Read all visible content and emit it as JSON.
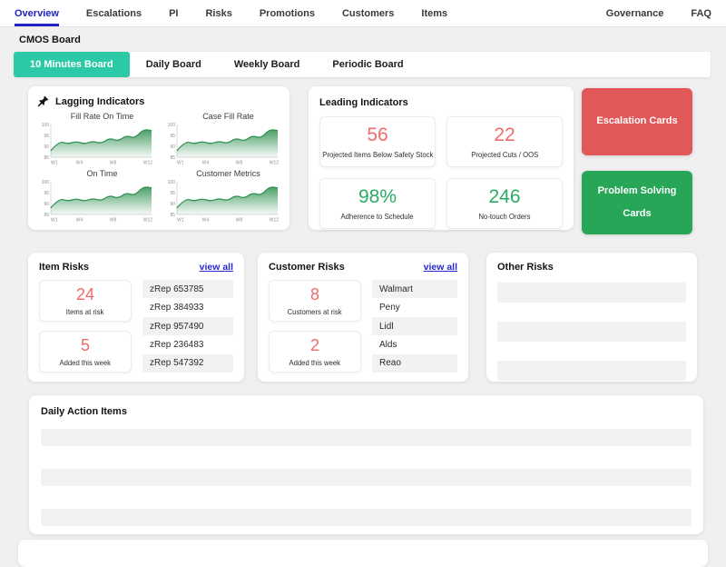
{
  "nav": {
    "items": [
      {
        "label": "Overview",
        "active": true
      },
      {
        "label": "Escalations"
      },
      {
        "label": "PI"
      },
      {
        "label": "Risks"
      },
      {
        "label": "Promotions"
      },
      {
        "label": "Customers"
      },
      {
        "label": "Items"
      }
    ],
    "right_items": [
      {
        "label": "Governance"
      },
      {
        "label": "FAQ"
      }
    ]
  },
  "page": {
    "title": "CMOS Board"
  },
  "board_tabs": [
    {
      "label": "10 Minutes Board",
      "active": true
    },
    {
      "label": "Daily Board"
    },
    {
      "label": "Weekly Board"
    },
    {
      "label": "Periodic Board"
    }
  ],
  "lagging": {
    "title": "Lagging Indicators",
    "icon": "pushpin-icon"
  },
  "chart_data": [
    {
      "type": "area",
      "title": "Fill Rate On Time",
      "x": [
        "W1",
        "W2",
        "W3",
        "W4",
        "W5",
        "W6",
        "W7",
        "W8",
        "W9",
        "W10",
        "W11",
        "W12",
        "W13"
      ],
      "values": [
        88,
        92.5,
        91,
        92.3,
        91,
        92.4,
        91.2,
        93.8,
        92.3,
        95,
        93.6,
        97.8,
        97.2
      ],
      "ylim": [
        85,
        100
      ],
      "yticks": [
        100,
        95,
        90,
        85
      ],
      "xtick_labels": [
        "W1",
        "W4",
        "W8",
        "W12"
      ],
      "xtick_positions": [
        0,
        3,
        7,
        11
      ],
      "line_color": "#2c8f4e",
      "grid": false,
      "legend": false
    },
    {
      "type": "area",
      "title": "Case Fill Rate",
      "x": [
        "W1",
        "W2",
        "W3",
        "W4",
        "W5",
        "W6",
        "W7",
        "W8",
        "W9",
        "W10",
        "W11",
        "W12",
        "W13"
      ],
      "values": [
        88,
        92.5,
        91,
        92.3,
        91,
        92.4,
        91.2,
        93.8,
        92.3,
        95,
        93.6,
        97.8,
        97.2
      ],
      "ylim": [
        85,
        100
      ],
      "yticks": [
        100,
        95,
        90,
        85
      ],
      "xtick_labels": [
        "W1",
        "W4",
        "W8",
        "W12"
      ],
      "xtick_positions": [
        0,
        3,
        7,
        11
      ],
      "line_color": "#2c8f4e",
      "grid": false,
      "legend": false
    },
    {
      "type": "area",
      "title": "On Time",
      "x": [
        "W1",
        "W2",
        "W3",
        "W4",
        "W5",
        "W6",
        "W7",
        "W8",
        "W9",
        "W10",
        "W11",
        "W12",
        "W13"
      ],
      "values": [
        88,
        92.5,
        91,
        92.3,
        91,
        92.4,
        91.2,
        93.8,
        92.3,
        95,
        93.6,
        97.8,
        97.2
      ],
      "ylim": [
        85,
        100
      ],
      "yticks": [
        100,
        95,
        90,
        85
      ],
      "xtick_labels": [
        "W1",
        "W4",
        "W8",
        "W12"
      ],
      "xtick_positions": [
        0,
        3,
        7,
        11
      ],
      "line_color": "#2c8f4e",
      "grid": false,
      "legend": false
    },
    {
      "type": "area",
      "title": "Customer Metrics",
      "x": [
        "W1",
        "W2",
        "W3",
        "W4",
        "W5",
        "W6",
        "W7",
        "W8",
        "W9",
        "W10",
        "W11",
        "W12",
        "W13"
      ],
      "values": [
        88,
        92.5,
        91,
        92.3,
        91,
        92.4,
        91.2,
        93.8,
        92.3,
        95,
        93.6,
        97.8,
        97.2
      ],
      "ylim": [
        85,
        100
      ],
      "yticks": [
        100,
        95,
        90,
        85
      ],
      "xtick_labels": [
        "W1",
        "W4",
        "W8",
        "W12"
      ],
      "xtick_positions": [
        0,
        3,
        7,
        11
      ],
      "line_color": "#2c8f4e",
      "grid": false,
      "legend": false
    }
  ],
  "leading": {
    "title": "Leading Indicators",
    "stats": [
      {
        "value": "56",
        "label": "Projected Items Below Safety Stock",
        "tone": "red"
      },
      {
        "value": "22",
        "label": "Projected Cuts / OOS",
        "tone": "red"
      },
      {
        "value": "98%",
        "label": "Adherence to Schedule",
        "tone": "green"
      },
      {
        "value": "246",
        "label": "No-touch Orders",
        "tone": "green"
      }
    ]
  },
  "action_cards": [
    {
      "label": "Escalation Cards",
      "tone": "danger",
      "color": "#e25757"
    },
    {
      "label": "Problem Solving Cards",
      "tone": "success",
      "color": "#27a658"
    }
  ],
  "item_risks": {
    "title": "Item Risks",
    "view_all": "view all",
    "stats": [
      {
        "value": "24",
        "label": "Items at risk",
        "tone": "red"
      },
      {
        "value": "5",
        "label": "Added this week",
        "tone": "red"
      }
    ],
    "list": [
      {
        "label": "zRep 653785"
      },
      {
        "label": "zRep 384933"
      },
      {
        "label": "zRep 957490"
      },
      {
        "label": "zRep 236483"
      },
      {
        "label": "zRep 547392"
      }
    ]
  },
  "customer_risks": {
    "title": "Customer Risks",
    "view_all": "view all",
    "stats": [
      {
        "value": "8",
        "label": "Customers at risk",
        "tone": "red"
      },
      {
        "value": "2",
        "label": "Added this week",
        "tone": "red"
      }
    ],
    "list": [
      {
        "label": "Walmart"
      },
      {
        "label": "Peny"
      },
      {
        "label": "Lidl"
      },
      {
        "label": "Alds"
      },
      {
        "label": "Reao"
      }
    ]
  },
  "other_risks": {
    "title": "Other Risks",
    "placeholder_rows": 3
  },
  "daily_actions": {
    "title": "Daily Action Items",
    "placeholder_rows": 3
  },
  "colors": {
    "accent_teal": "#2cc9a6",
    "danger_red": "#e25757",
    "success_green": "#27a658",
    "stat_red": "#ef6b6b",
    "stat_green": "#2bab64",
    "link_blue": "#2727d4",
    "nav_active_blue": "#2222c4",
    "chart_green": "#2c8f4e"
  }
}
